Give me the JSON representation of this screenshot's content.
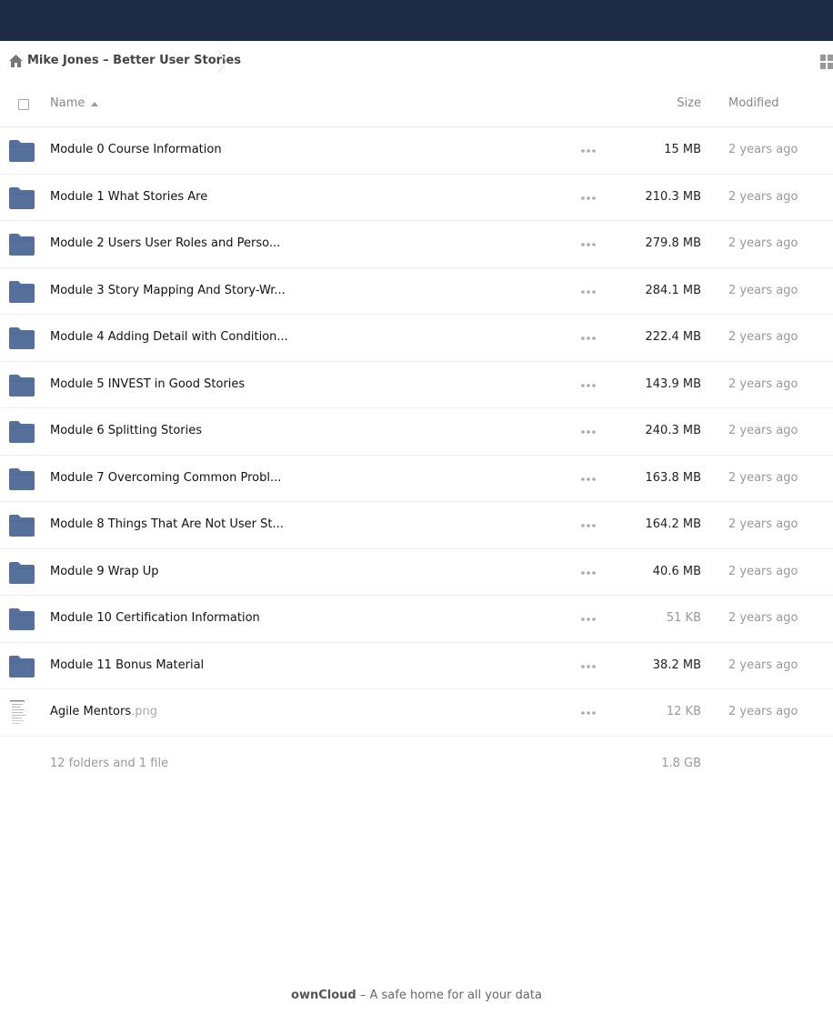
{
  "breadcrumb": {
    "home_icon": "home-icon",
    "current": "Mike Jones – Better User Stories"
  },
  "view_toggle_icon": "grid-view-icon",
  "table": {
    "headers": {
      "name": "Name",
      "size": "Size",
      "modified": "Modified"
    },
    "sort": "name-ascending",
    "rows": [
      {
        "type": "folder",
        "name": "Module 0 Course Information",
        "ext": "",
        "size": "15 MB",
        "modified": "2 years ago",
        "size_light": false
      },
      {
        "type": "folder",
        "name": "Module 1 What Stories Are",
        "ext": "",
        "size": "210.3 MB",
        "modified": "2 years ago",
        "size_light": false
      },
      {
        "type": "folder",
        "name": "Module 2 Users User Roles and Perso...",
        "ext": "",
        "size": "279.8 MB",
        "modified": "2 years ago",
        "size_light": false
      },
      {
        "type": "folder",
        "name": "Module 3 Story Mapping And Story-Wr...",
        "ext": "",
        "size": "284.1 MB",
        "modified": "2 years ago",
        "size_light": false
      },
      {
        "type": "folder",
        "name": "Module 4 Adding Detail with Condition...",
        "ext": "",
        "size": "222.4 MB",
        "modified": "2 years ago",
        "size_light": false
      },
      {
        "type": "folder",
        "name": "Module 5 INVEST in Good Stories",
        "ext": "",
        "size": "143.9 MB",
        "modified": "2 years ago",
        "size_light": false
      },
      {
        "type": "folder",
        "name": "Module 6 Splitting Stories",
        "ext": "",
        "size": "240.3 MB",
        "modified": "2 years ago",
        "size_light": false
      },
      {
        "type": "folder",
        "name": "Module 7 Overcoming Common Probl...",
        "ext": "",
        "size": "163.8 MB",
        "modified": "2 years ago",
        "size_light": false
      },
      {
        "type": "folder",
        "name": "Module 8 Things That Are Not User St...",
        "ext": "",
        "size": "164.2 MB",
        "modified": "2 years ago",
        "size_light": false
      },
      {
        "type": "folder",
        "name": "Module 9 Wrap Up",
        "ext": "",
        "size": "40.6 MB",
        "modified": "2 years ago",
        "size_light": false
      },
      {
        "type": "folder",
        "name": "Module 10 Certification Information",
        "ext": "",
        "size": "51 KB",
        "modified": "2 years ago",
        "size_light": true
      },
      {
        "type": "folder",
        "name": "Module 11 Bonus Material",
        "ext": "",
        "size": "38.2 MB",
        "modified": "2 years ago",
        "size_light": false
      },
      {
        "type": "file",
        "name": "Agile Mentors",
        "ext": ".png",
        "size": "12 KB",
        "modified": "2 years ago",
        "size_light": true
      }
    ]
  },
  "summary": {
    "count": "12 folders and 1 file",
    "total": "1.8 GB"
  },
  "footer": {
    "brand": "ownCloud",
    "tagline": " – A safe home for all your data"
  },
  "colors": {
    "topbar": "#1d2b45",
    "folder": "#55709b"
  }
}
